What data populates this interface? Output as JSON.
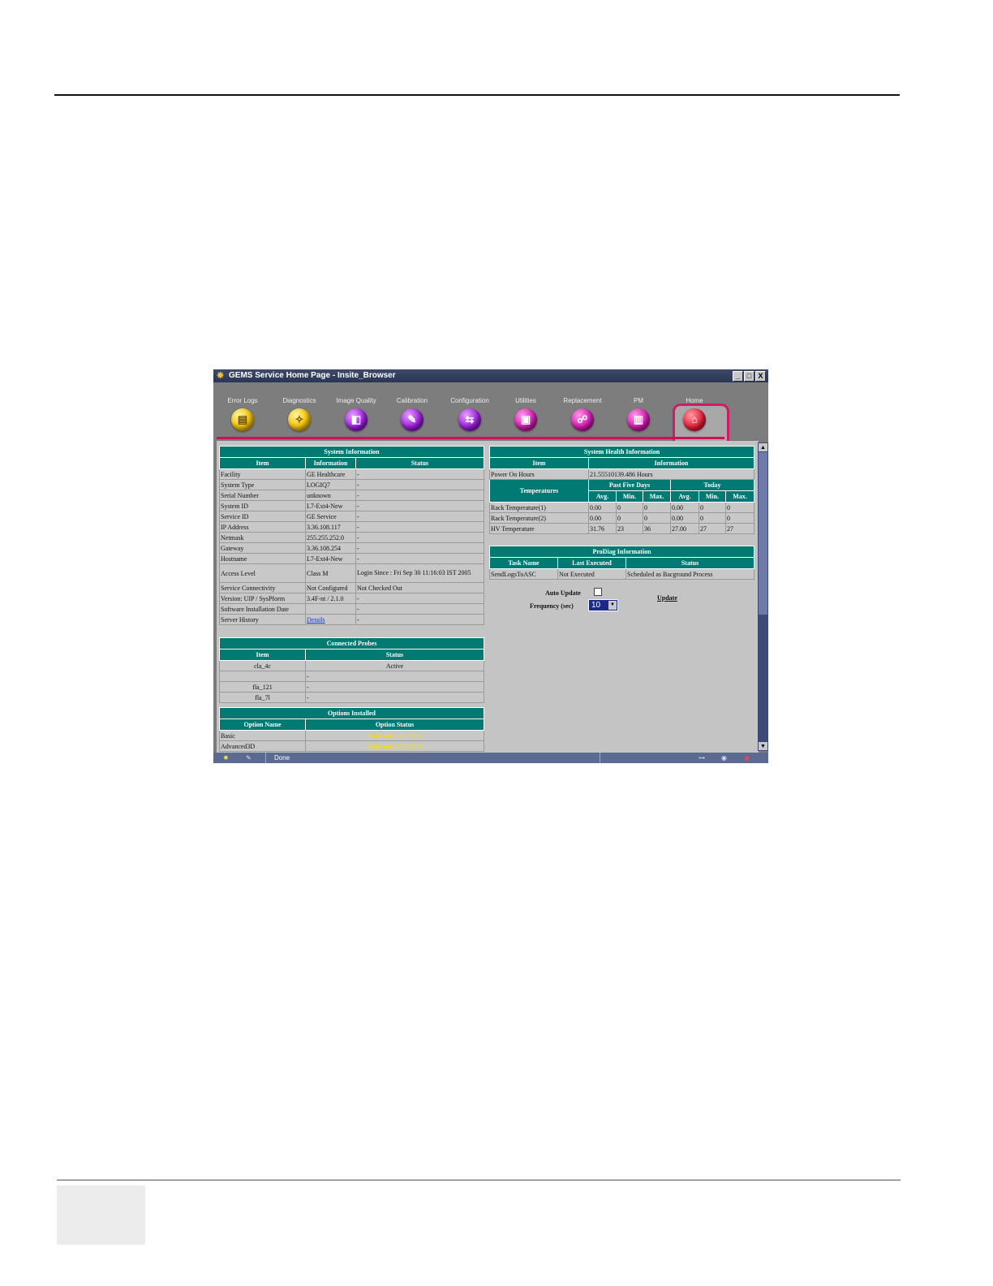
{
  "window": {
    "title": "GEMS Service Home Page - Insite_Browser",
    "controls": [
      "_",
      "□",
      "X"
    ]
  },
  "toolbar": {
    "tools": [
      {
        "label": "Error Logs",
        "icon": "error-logs-icon",
        "color": "yellow",
        "glyph": "▤"
      },
      {
        "label": "Diagnostics",
        "icon": "diagnostics-icon",
        "color": "yellow",
        "glyph": "✧"
      },
      {
        "label": "Image Quality",
        "icon": "image-quality-icon",
        "color": "purple",
        "glyph": "◧"
      },
      {
        "label": "Calibration",
        "icon": "calibration-icon",
        "color": "purple",
        "glyph": "✎"
      },
      {
        "label": "Configuration",
        "icon": "configuration-icon",
        "color": "purple",
        "glyph": "⇆"
      },
      {
        "label": "Utilities",
        "icon": "utilities-icon",
        "color": "magenta",
        "glyph": "▣"
      },
      {
        "label": "Replacement",
        "icon": "replacement-icon",
        "color": "magenta",
        "glyph": "☍"
      },
      {
        "label": "PM",
        "icon": "pm-icon",
        "color": "magenta",
        "glyph": "▥"
      },
      {
        "label": "Home",
        "icon": "home-icon",
        "color": "red",
        "glyph": "⌂"
      }
    ]
  },
  "system_info": {
    "title": "System Information",
    "headers": [
      "Item",
      "Information",
      "Status"
    ],
    "rows": [
      [
        "Facility",
        "GE Healthcare",
        "-"
      ],
      [
        "System Type",
        "LOGIQ7",
        "-"
      ],
      [
        "Serial Number",
        "unknown",
        "-"
      ],
      [
        "System ID",
        "L7-Ext4-New",
        "-"
      ],
      [
        "Service ID",
        "GE Service",
        "-"
      ],
      [
        "IP Address",
        "3.36.108.117",
        "-"
      ],
      [
        "Netmask",
        "255.255.252.0",
        "-"
      ],
      [
        "Gateway",
        "3.36.108.254",
        "-"
      ],
      [
        "Hostname",
        "L7-Ext4-New",
        "-"
      ],
      [
        "Access Level",
        "Class M",
        "Login Since : Fri Sep 30 11:16:03 IST 2005"
      ],
      [
        "Service Connectivity",
        "Not Configured",
        "Not Checked Out"
      ],
      [
        "Version: UIP / SysPform",
        "3.4F-nt / 2.1.0",
        "-"
      ],
      [
        "Software Installation Date",
        "",
        "-"
      ],
      [
        "Server History",
        "Details",
        "-"
      ]
    ]
  },
  "probes": {
    "title": "Connected Probes",
    "headers": [
      "Item",
      "Status"
    ],
    "rows": [
      [
        "cla_4c",
        "Active"
      ],
      [
        "",
        "-"
      ],
      [
        "fla_121",
        "-"
      ],
      [
        "fla_7l",
        "-"
      ]
    ]
  },
  "options": {
    "title": "Options Installed",
    "headers": [
      "Option Name",
      "Option Status"
    ],
    "rows": [
      [
        "Basic",
        "Valid until 20051231"
      ],
      [
        "Advanced3D",
        "Valid until 20051231"
      ]
    ]
  },
  "health": {
    "title": "System Health Information",
    "headers": [
      "Item",
      "Information"
    ],
    "power_label": "Power On Hours",
    "power_value": "21.55510139.486 Hours",
    "temps_label": "Temperatures",
    "past_label": "Past Five Days",
    "today_label": "Today",
    "sub_headers": [
      "Avg.",
      "Min.",
      "Max.",
      "Avg.",
      "Min.",
      "Max."
    ],
    "rows": [
      [
        "Rack Temperature(1)",
        "0.00",
        "0",
        "0",
        "0.00",
        "0",
        "0"
      ],
      [
        "Rack Temperature(2)",
        "0.00",
        "0",
        "0",
        "0.00",
        "0",
        "0"
      ],
      [
        "HV Temperature",
        "31.76",
        "23",
        "36",
        "27.00",
        "27",
        "27"
      ]
    ]
  },
  "prodiag": {
    "title": "ProDiag Information",
    "headers": [
      "Task Name",
      "Last Executed",
      "Status"
    ],
    "rows": [
      [
        "SendLogsToASC",
        "Not Executed",
        "Scheduled as Bacground Process"
      ]
    ]
  },
  "controls": {
    "auto_update_label": "Auto Update",
    "frequency_label": "Frequency (sec)",
    "frequency_value": "10",
    "update_link": "Update"
  },
  "status": {
    "text": "Done"
  }
}
